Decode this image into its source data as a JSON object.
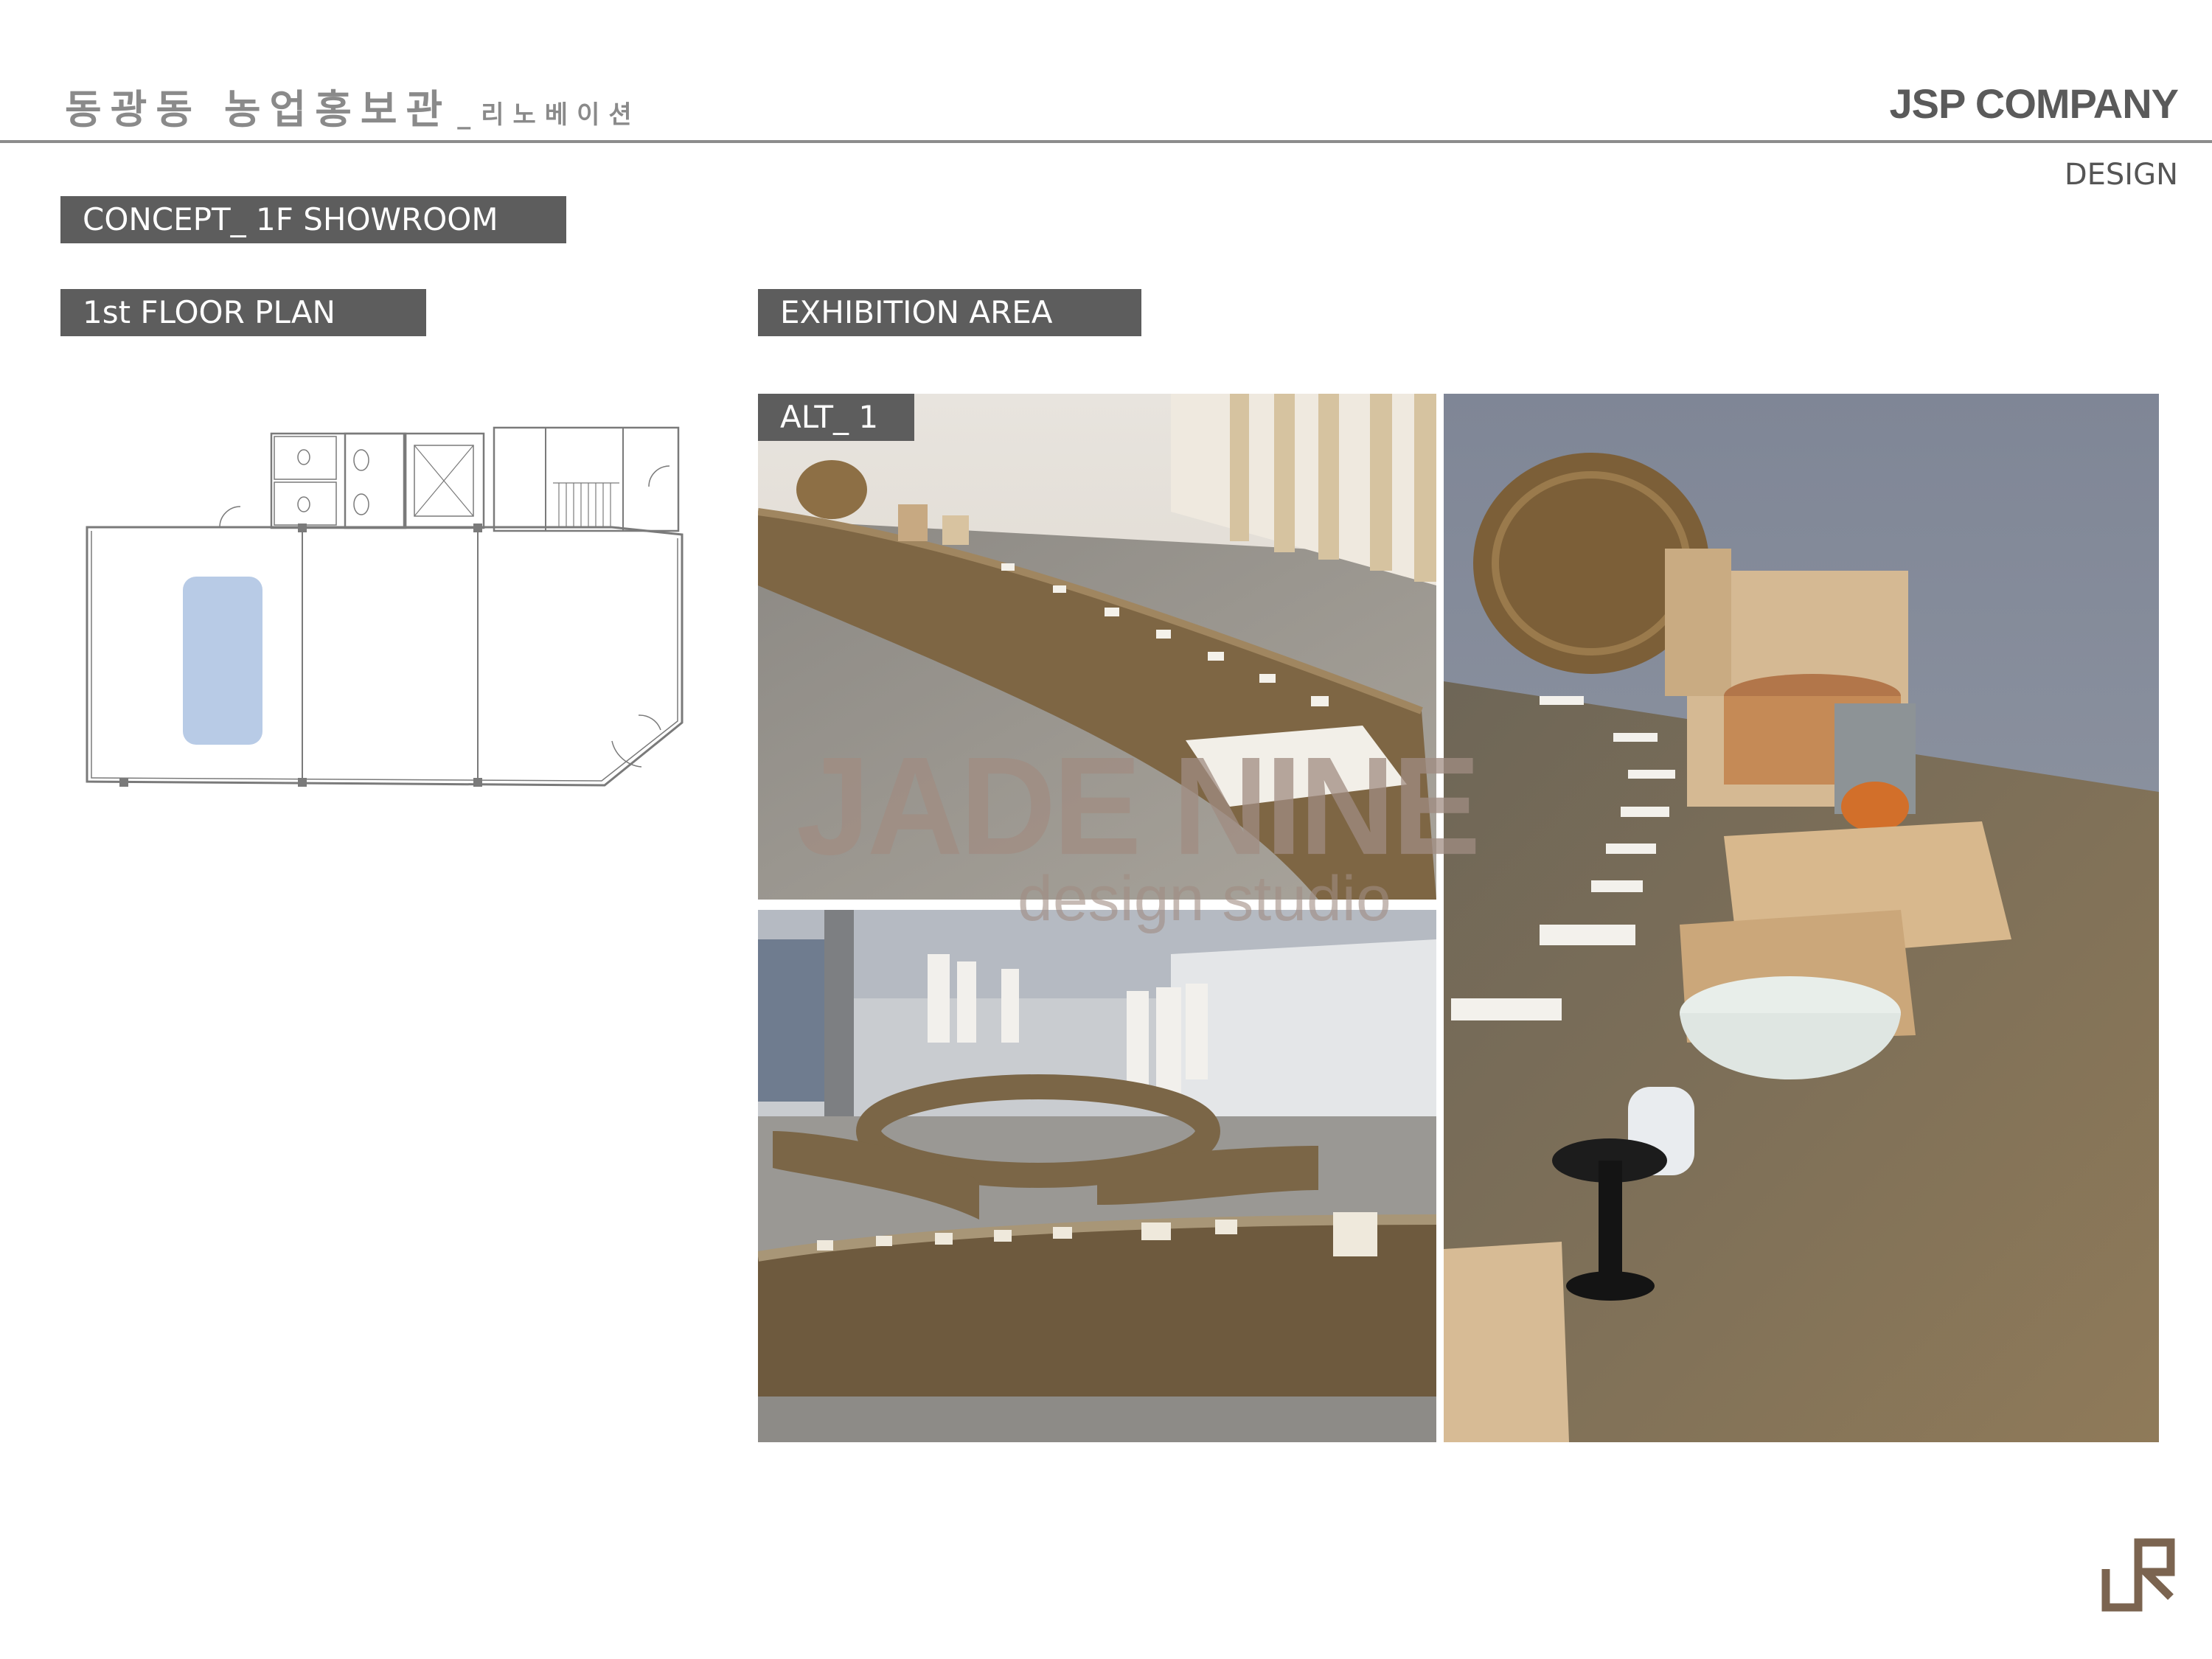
{
  "header": {
    "title": "동광동 농업홍보관",
    "separator": "_",
    "subtitle": "리노베이션",
    "company": "JSP COMPANY",
    "section": "DESIGN"
  },
  "tags": {
    "concept": "CONCEPT_ 1F SHOWROOM",
    "floor_plan": "1st FLOOR PLAN",
    "exhibition": "EXHIBITION AREA",
    "alt": "ALT_ 1"
  },
  "watermark": {
    "main": "JADE NINE",
    "sub": "design studio"
  },
  "colors": {
    "tag_bg": "#5d5d5d",
    "highlight_zone": "#b8cbe6",
    "logo": "#7b6450"
  },
  "icons": {
    "logo": "jsp-logo-icon"
  }
}
